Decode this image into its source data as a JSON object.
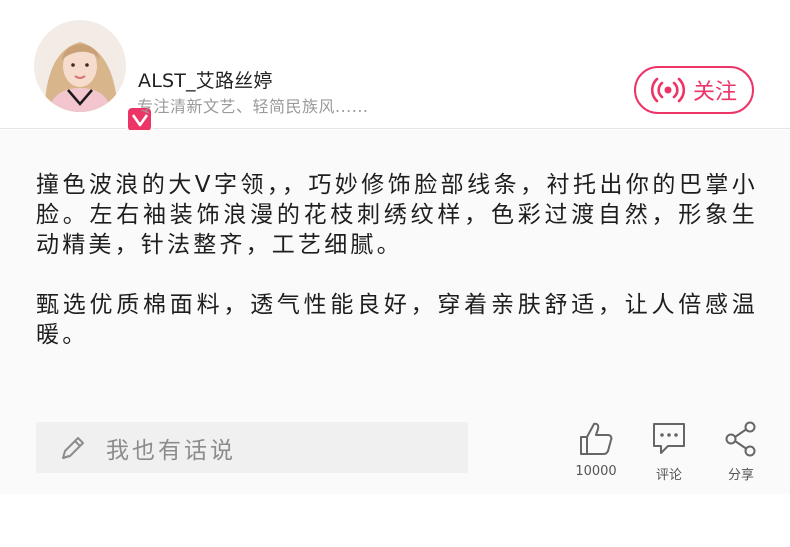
{
  "author": {
    "name": "ALST_艾路丝婷",
    "tagline": "专注清新文艺、轻简民族风......"
  },
  "follow_button": {
    "label": "关注"
  },
  "article": {
    "paragraphs": [
      "撞色波浪的大V字领，，巧妙修饰脸部线条，衬托出你的巴掌小脸。左右袖装饰浪漫的花枝刺绣纹样，色彩过渡自然，形象生动精美，针法整齐，工艺细腻。",
      "甄选优质棉面料，透气性能良好，穿着亲肤舒适，让人倍感温暖。"
    ]
  },
  "comment_input": {
    "placeholder": "我也有话说"
  },
  "actions": {
    "like_count": "10000",
    "comment_label": "评论",
    "share_label": "分享"
  },
  "colors": {
    "accent": "#ec3467",
    "muted_text": "#9a9a9a",
    "content_bg": "#fafafa"
  },
  "icons": [
    "verified-badge-icon",
    "broadcast-icon",
    "pencil-icon",
    "thumbs-up-icon",
    "comment-bubble-icon",
    "share-icon"
  ]
}
